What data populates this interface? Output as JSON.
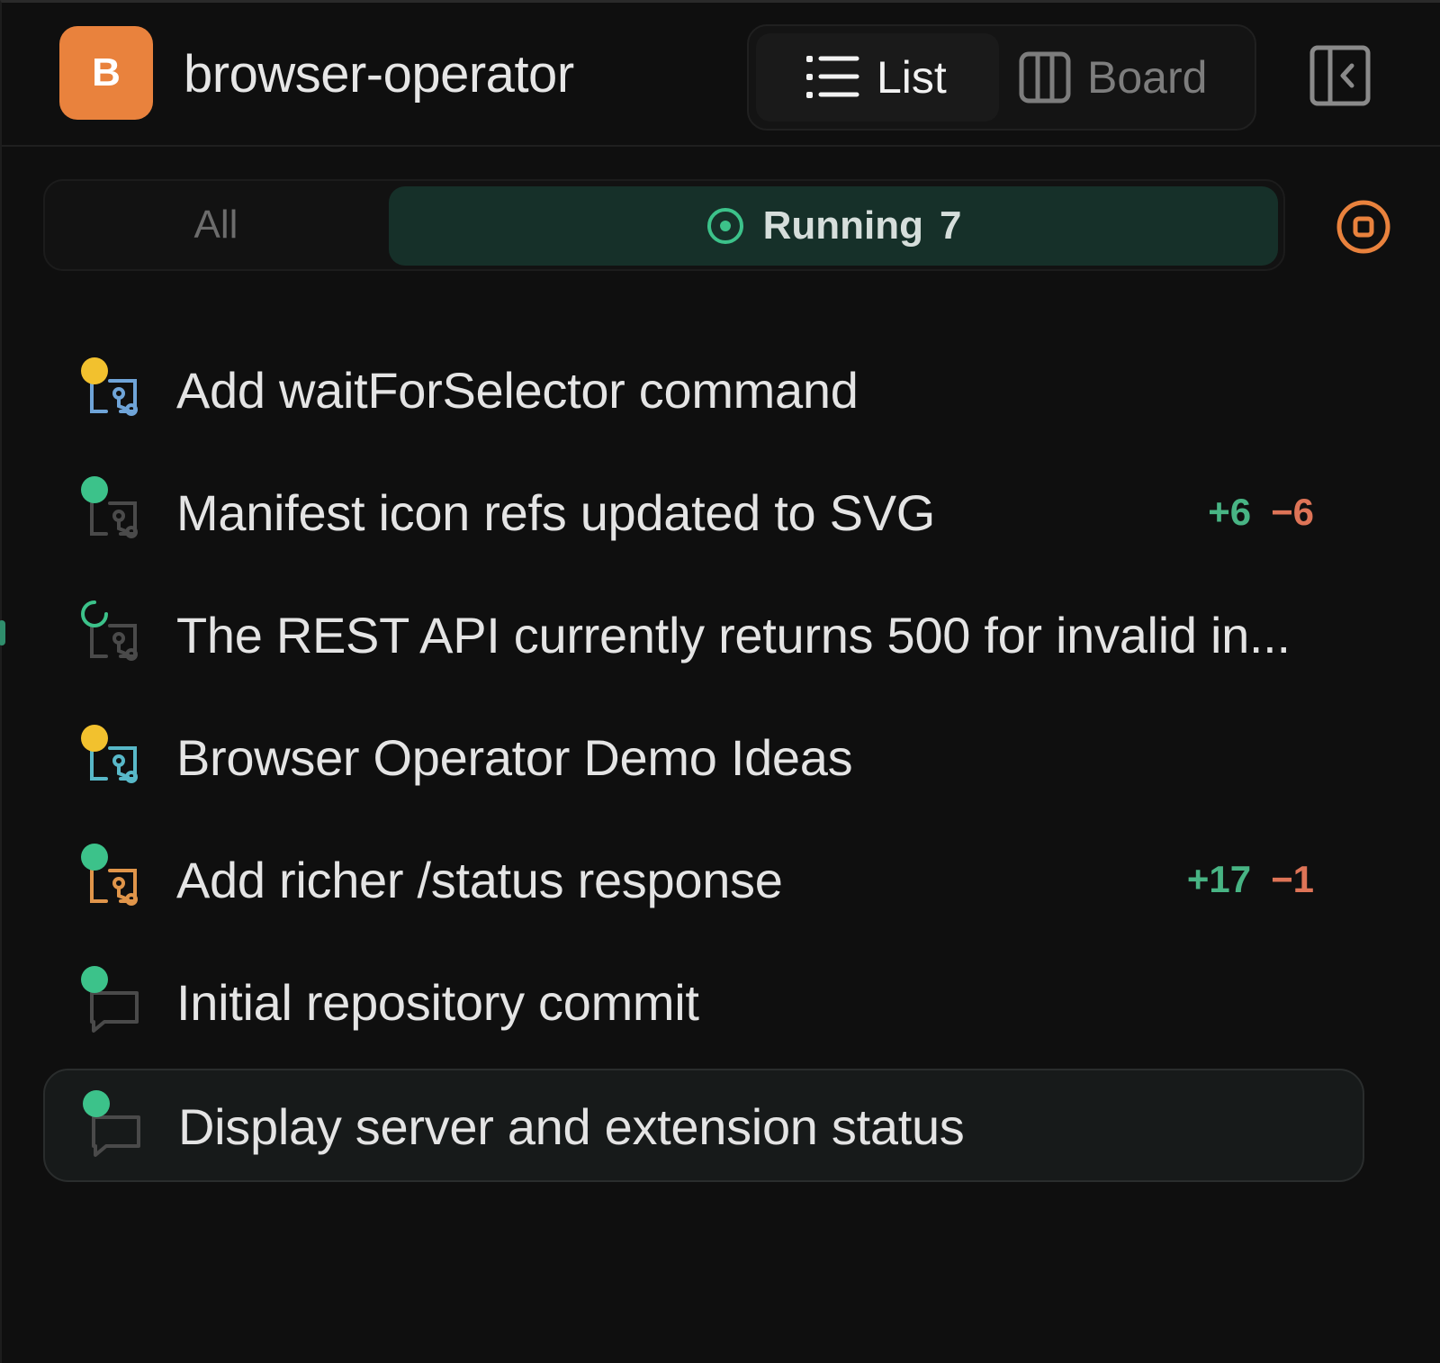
{
  "header": {
    "avatar_letter": "B",
    "project_name": "browser-operator",
    "view_list_label": "List",
    "view_board_label": "Board"
  },
  "filters": {
    "all_label": "All",
    "running_label": "Running",
    "running_count": "7"
  },
  "colors": {
    "accent_orange": "#e9823d",
    "running_bg": "#163029",
    "status_green": "#3cc28a",
    "status_yellow": "#f2c12e",
    "diff_add": "#48b484",
    "diff_del": "#de7457"
  },
  "tasks": [
    {
      "title": "Add waitForSelector command",
      "status": "yellow",
      "icon": "git-pull-request-icon",
      "icon_color": "#6fa4d8",
      "additions": "",
      "deletions": ""
    },
    {
      "title": "Manifest icon refs updated to SVG",
      "status": "green",
      "icon": "git-pull-request-icon",
      "icon_color": "#4a4a4a",
      "additions": "+6",
      "deletions": "−6"
    },
    {
      "title": "The REST API currently returns 500 for invalid in...",
      "status": "spinner",
      "icon": "git-pull-request-icon",
      "icon_color": "#4a4a4a",
      "additions": "",
      "deletions": ""
    },
    {
      "title": "Browser Operator Demo Ideas",
      "status": "yellow",
      "icon": "git-pull-request-icon",
      "icon_color": "#58b8c8",
      "additions": "",
      "deletions": ""
    },
    {
      "title": "Add richer /status response",
      "status": "green",
      "icon": "git-pull-request-icon",
      "icon_color": "#e0954a",
      "additions": "+17",
      "deletions": "−1"
    },
    {
      "title": "Initial repository commit",
      "status": "green",
      "icon": "chat-bubble-icon",
      "icon_color": "#4a4a4a",
      "additions": "",
      "deletions": ""
    },
    {
      "title": "Display server and extension status",
      "status": "green",
      "icon": "chat-bubble-icon",
      "icon_color": "#4a4a4a",
      "additions": "",
      "deletions": "",
      "selected": true
    }
  ]
}
